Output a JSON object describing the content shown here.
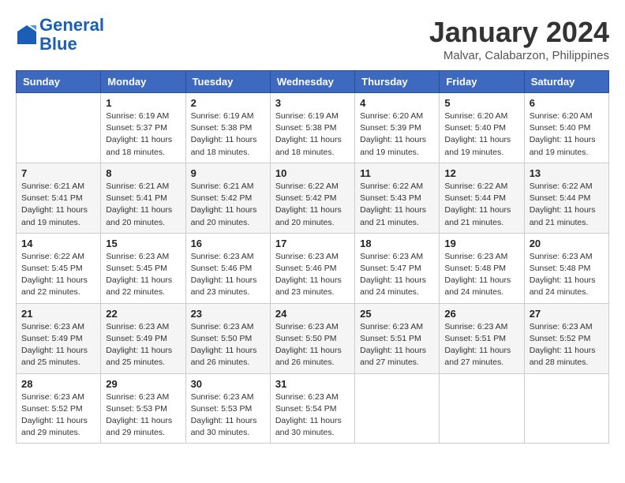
{
  "header": {
    "logo_line1": "General",
    "logo_line2": "Blue",
    "month_title": "January 2024",
    "subtitle": "Malvar, Calabarzon, Philippines"
  },
  "weekdays": [
    "Sunday",
    "Monday",
    "Tuesday",
    "Wednesday",
    "Thursday",
    "Friday",
    "Saturday"
  ],
  "weeks": [
    [
      {
        "day": "",
        "detail": ""
      },
      {
        "day": "1",
        "detail": "Sunrise: 6:19 AM\nSunset: 5:37 PM\nDaylight: 11 hours\nand 18 minutes."
      },
      {
        "day": "2",
        "detail": "Sunrise: 6:19 AM\nSunset: 5:38 PM\nDaylight: 11 hours\nand 18 minutes."
      },
      {
        "day": "3",
        "detail": "Sunrise: 6:19 AM\nSunset: 5:38 PM\nDaylight: 11 hours\nand 18 minutes."
      },
      {
        "day": "4",
        "detail": "Sunrise: 6:20 AM\nSunset: 5:39 PM\nDaylight: 11 hours\nand 19 minutes."
      },
      {
        "day": "5",
        "detail": "Sunrise: 6:20 AM\nSunset: 5:40 PM\nDaylight: 11 hours\nand 19 minutes."
      },
      {
        "day": "6",
        "detail": "Sunrise: 6:20 AM\nSunset: 5:40 PM\nDaylight: 11 hours\nand 19 minutes."
      }
    ],
    [
      {
        "day": "7",
        "detail": "Sunrise: 6:21 AM\nSunset: 5:41 PM\nDaylight: 11 hours\nand 19 minutes."
      },
      {
        "day": "8",
        "detail": "Sunrise: 6:21 AM\nSunset: 5:41 PM\nDaylight: 11 hours\nand 20 minutes."
      },
      {
        "day": "9",
        "detail": "Sunrise: 6:21 AM\nSunset: 5:42 PM\nDaylight: 11 hours\nand 20 minutes."
      },
      {
        "day": "10",
        "detail": "Sunrise: 6:22 AM\nSunset: 5:42 PM\nDaylight: 11 hours\nand 20 minutes."
      },
      {
        "day": "11",
        "detail": "Sunrise: 6:22 AM\nSunset: 5:43 PM\nDaylight: 11 hours\nand 21 minutes."
      },
      {
        "day": "12",
        "detail": "Sunrise: 6:22 AM\nSunset: 5:44 PM\nDaylight: 11 hours\nand 21 minutes."
      },
      {
        "day": "13",
        "detail": "Sunrise: 6:22 AM\nSunset: 5:44 PM\nDaylight: 11 hours\nand 21 minutes."
      }
    ],
    [
      {
        "day": "14",
        "detail": "Sunrise: 6:22 AM\nSunset: 5:45 PM\nDaylight: 11 hours\nand 22 minutes."
      },
      {
        "day": "15",
        "detail": "Sunrise: 6:23 AM\nSunset: 5:45 PM\nDaylight: 11 hours\nand 22 minutes."
      },
      {
        "day": "16",
        "detail": "Sunrise: 6:23 AM\nSunset: 5:46 PM\nDaylight: 11 hours\nand 23 minutes."
      },
      {
        "day": "17",
        "detail": "Sunrise: 6:23 AM\nSunset: 5:46 PM\nDaylight: 11 hours\nand 23 minutes."
      },
      {
        "day": "18",
        "detail": "Sunrise: 6:23 AM\nSunset: 5:47 PM\nDaylight: 11 hours\nand 24 minutes."
      },
      {
        "day": "19",
        "detail": "Sunrise: 6:23 AM\nSunset: 5:48 PM\nDaylight: 11 hours\nand 24 minutes."
      },
      {
        "day": "20",
        "detail": "Sunrise: 6:23 AM\nSunset: 5:48 PM\nDaylight: 11 hours\nand 24 minutes."
      }
    ],
    [
      {
        "day": "21",
        "detail": "Sunrise: 6:23 AM\nSunset: 5:49 PM\nDaylight: 11 hours\nand 25 minutes."
      },
      {
        "day": "22",
        "detail": "Sunrise: 6:23 AM\nSunset: 5:49 PM\nDaylight: 11 hours\nand 25 minutes."
      },
      {
        "day": "23",
        "detail": "Sunrise: 6:23 AM\nSunset: 5:50 PM\nDaylight: 11 hours\nand 26 minutes."
      },
      {
        "day": "24",
        "detail": "Sunrise: 6:23 AM\nSunset: 5:50 PM\nDaylight: 11 hours\nand 26 minutes."
      },
      {
        "day": "25",
        "detail": "Sunrise: 6:23 AM\nSunset: 5:51 PM\nDaylight: 11 hours\nand 27 minutes."
      },
      {
        "day": "26",
        "detail": "Sunrise: 6:23 AM\nSunset: 5:51 PM\nDaylight: 11 hours\nand 27 minutes."
      },
      {
        "day": "27",
        "detail": "Sunrise: 6:23 AM\nSunset: 5:52 PM\nDaylight: 11 hours\nand 28 minutes."
      }
    ],
    [
      {
        "day": "28",
        "detail": "Sunrise: 6:23 AM\nSunset: 5:52 PM\nDaylight: 11 hours\nand 29 minutes."
      },
      {
        "day": "29",
        "detail": "Sunrise: 6:23 AM\nSunset: 5:53 PM\nDaylight: 11 hours\nand 29 minutes."
      },
      {
        "day": "30",
        "detail": "Sunrise: 6:23 AM\nSunset: 5:53 PM\nDaylight: 11 hours\nand 30 minutes."
      },
      {
        "day": "31",
        "detail": "Sunrise: 6:23 AM\nSunset: 5:54 PM\nDaylight: 11 hours\nand 30 minutes."
      },
      {
        "day": "",
        "detail": ""
      },
      {
        "day": "",
        "detail": ""
      },
      {
        "day": "",
        "detail": ""
      }
    ]
  ]
}
